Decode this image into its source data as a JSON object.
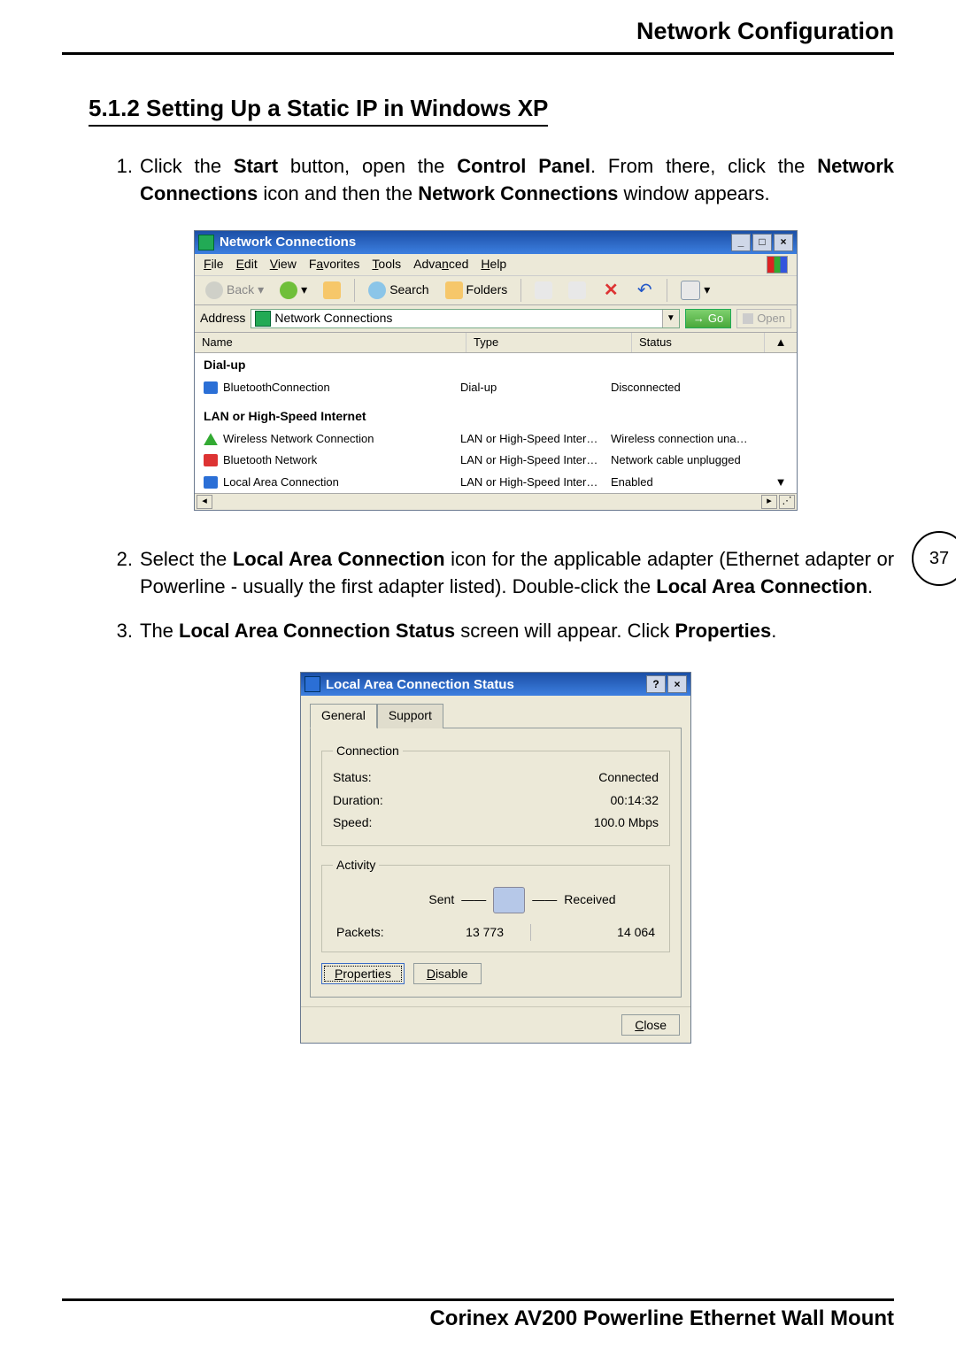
{
  "header": {
    "title": "Network Configuration"
  },
  "section": {
    "heading": "5.1.2 Setting Up a Static IP in Windows XP"
  },
  "page_number": "37",
  "footer": {
    "title": "Corinex AV200 Powerline Ethernet Wall Mount"
  },
  "steps": {
    "s1": {
      "num": "1.",
      "pre1": "Click the ",
      "b1": "Start",
      "mid1": " button, open the ",
      "b2": "Control Panel",
      "mid2": ". From there, click the ",
      "b3": "Network Connections",
      "mid3": " icon and then the ",
      "b4": "Network Connections",
      "post": " window appears."
    },
    "s2": {
      "num": "2.",
      "pre1": "Select the ",
      "b1": "Local Area Connection",
      "mid1": " icon for the applicable adapter (Ethernet adapter or Powerline - usually the first adapter listed). Double-click the ",
      "b2": "Local Area Connection",
      "post": "."
    },
    "s3": {
      "num": "3.",
      "pre1": "The ",
      "b1": "Local Area Connection Status",
      "mid1": " screen will appear. Click ",
      "b2": "Properties",
      "post": "."
    }
  },
  "ss1": {
    "title": "Network Connections",
    "menu": {
      "file": "File",
      "edit": "Edit",
      "view": "View",
      "favorites": "Favorites",
      "tools": "Tools",
      "advanced": "Advanced",
      "help": "Help"
    },
    "win": {
      "min": "_",
      "max": "□",
      "close": "×"
    },
    "toolbar": {
      "back": "Back",
      "search": "Search",
      "folders": "Folders"
    },
    "addr": {
      "label": "Address",
      "value": "Network Connections",
      "go": "Go",
      "open": "Open"
    },
    "headers": {
      "name": "Name",
      "type": "Type",
      "status": "Status"
    },
    "group1": "Dial-up",
    "group2": "LAN or High-Speed Internet",
    "rows": [
      {
        "name": "BluetoothConnection",
        "type": "Dial-up",
        "status": "Disconnected"
      },
      {
        "name": "Wireless Network Connection",
        "type": "LAN or High-Speed Inter…",
        "status": "Wireless connection una…"
      },
      {
        "name": "Bluetooth Network",
        "type": "LAN or High-Speed Inter…",
        "status": "Network cable unplugged"
      },
      {
        "name": "Local Area Connection",
        "type": "LAN or High-Speed Inter…",
        "status": "Enabled"
      }
    ]
  },
  "ss2": {
    "title": "Local Area Connection Status",
    "win": {
      "help": "?",
      "close": "×"
    },
    "tabs": {
      "general": "General",
      "support": "Support"
    },
    "conn_legend": "Connection",
    "status_label": "Status:",
    "status_value": "Connected",
    "duration_label": "Duration:",
    "duration_value": "00:14:32",
    "speed_label": "Speed:",
    "speed_value": "100.0 Mbps",
    "activity_legend": "Activity",
    "sent": "Sent",
    "received": "Received",
    "packets_label": "Packets:",
    "packets_sent": "13 773",
    "packets_recv": "14 064",
    "btn_properties": "Properties",
    "btn_disable": "Disable",
    "btn_close": "Close"
  }
}
